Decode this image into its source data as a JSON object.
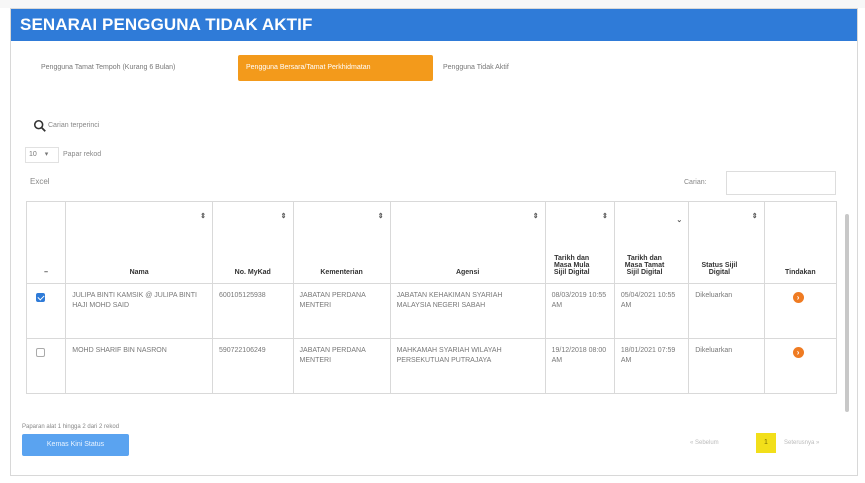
{
  "header": {
    "title": "SENARAI PENGGUNA TIDAK AKTIF"
  },
  "tabs": [
    {
      "label": "Pengguna Tamat Tempoh (Kurang 6 Bulan)",
      "active": false
    },
    {
      "label": "Pengguna Bersara/Tamat Perkhidmatan",
      "active": true
    },
    {
      "label": "Pengguna Tidak Aktif",
      "active": false
    }
  ],
  "search": {
    "label": "Carian terperinci",
    "icon": "search-icon"
  },
  "length": {
    "value": "10",
    "label": "Papar rekod"
  },
  "export_label": "Excel",
  "filter": {
    "label": "Carian:",
    "value": ""
  },
  "table": {
    "headers": {
      "select": "",
      "nama": "Nama",
      "mykad": "No. MyKad",
      "kementerian": "Kementerian",
      "agensi": "Agensi",
      "mula": "Tarikh dan Masa Mula Sijil Digital",
      "tamat": "Tarikh dan Masa Tamat Sijil Digital",
      "status": "Status Sijil Digital",
      "tindakan": "Tindakan"
    },
    "rows": [
      {
        "checked": true,
        "nama": "JULIPA BINTI KAMSIK @ JULIPA BINTI HAJI MOHD SAID",
        "mykad": "600105125938",
        "kementerian": "JABATAN PERDANA MENTERI",
        "agensi": "JABATAN KEHAKIMAN SYARIAH MALAYSIA NEGERI SABAH",
        "mula": "08/03/2019 10:55 AM",
        "tamat": "05/04/2021 10:55 AM",
        "status": "Dikeluarkan"
      },
      {
        "checked": false,
        "nama": "MOHD SHARIF BIN NASRON",
        "mykad": "590722106249",
        "kementerian": "JABATAN PERDANA MENTERI",
        "agensi": "MAHKAMAH SYARIAH WILAYAH PERSEKUTUAN PUTRAJAYA",
        "mula": "19/12/2018 08:00 AM",
        "tamat": "18/01/2021 07:59 AM",
        "status": "Dikeluarkan"
      }
    ]
  },
  "footer": {
    "info": "Paparan alat 1 hingga 2 dari 2 rekod",
    "button": "Kemas Kini Status",
    "prev": "« Sebelum",
    "page": "1",
    "next": "Seterusnya »"
  },
  "colors": {
    "header": "#2f7bd8",
    "active_tab": "#f39a1b",
    "action": "#ef7b22",
    "button": "#5aa3f0",
    "pager_active": "#f2df1a"
  }
}
